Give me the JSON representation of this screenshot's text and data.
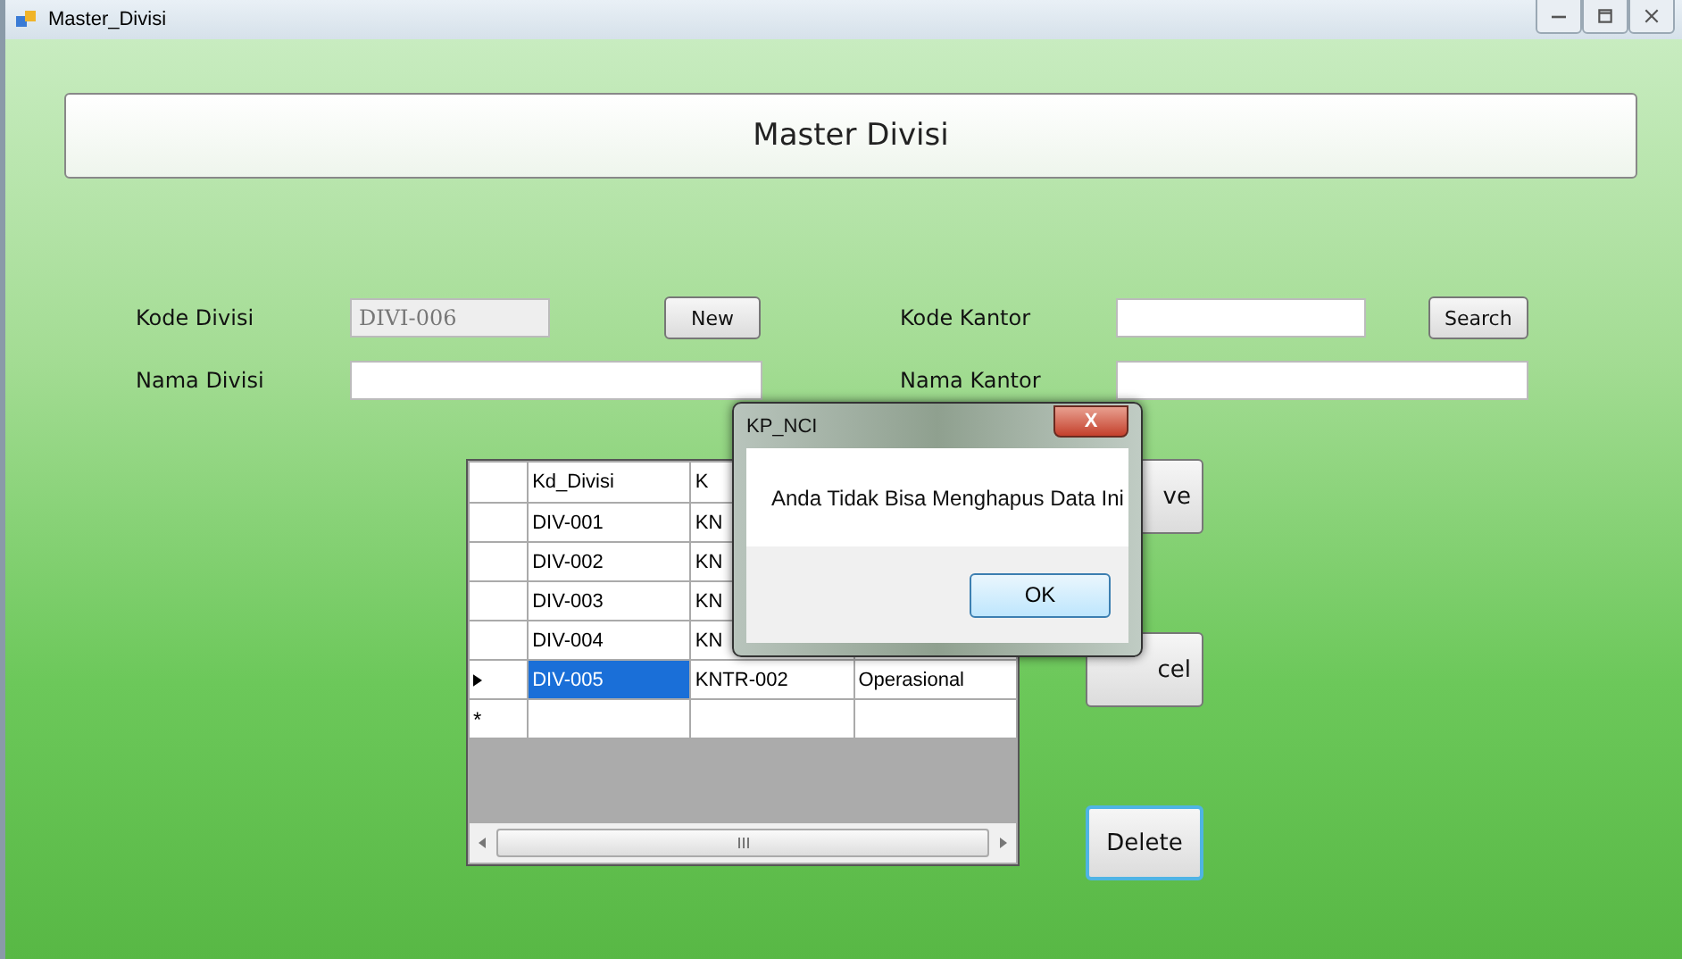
{
  "window": {
    "title": "Master_Divisi"
  },
  "header": {
    "title": "Master Divisi"
  },
  "form": [
    {
      "label": "Kode Divisi",
      "value": "DIVI-006",
      "disabled": true,
      "button": "New",
      "label2": "Kode Kantor",
      "button2": "Search"
    },
    {
      "label": "Nama Divisi",
      "disabled": false,
      "label2": "Nama Kantor"
    }
  ],
  "table": {
    "columns": [
      "Kd_Divisi",
      "K"
    ],
    "rows": [
      {
        "cells": [
          "DIV-001",
          "KN"
        ],
        "current": false,
        "selected": false
      },
      {
        "cells": [
          "DIV-002",
          "KN"
        ],
        "current": false,
        "selected": false
      },
      {
        "cells": [
          "DIV-003",
          "KN"
        ],
        "current": false,
        "selected": false
      },
      {
        "cells": [
          "DIV-004",
          "KN"
        ],
        "current": false,
        "selected": false
      },
      {
        "cells": [
          "DIV-005",
          "KNTR-002",
          "Operasional"
        ],
        "current": true,
        "selected": true
      }
    ],
    "new_row_marker": "*"
  },
  "buttons": [
    {
      "label": "ve",
      "focused": false
    },
    {
      "label": "cel",
      "focused": false
    },
    {
      "label": "Delete",
      "focused": true
    }
  ],
  "dialog": {
    "title": "KP_NCI",
    "close": "X",
    "message": "Anda Tidak Bisa Menghapus Data Ini",
    "button": "OK"
  }
}
